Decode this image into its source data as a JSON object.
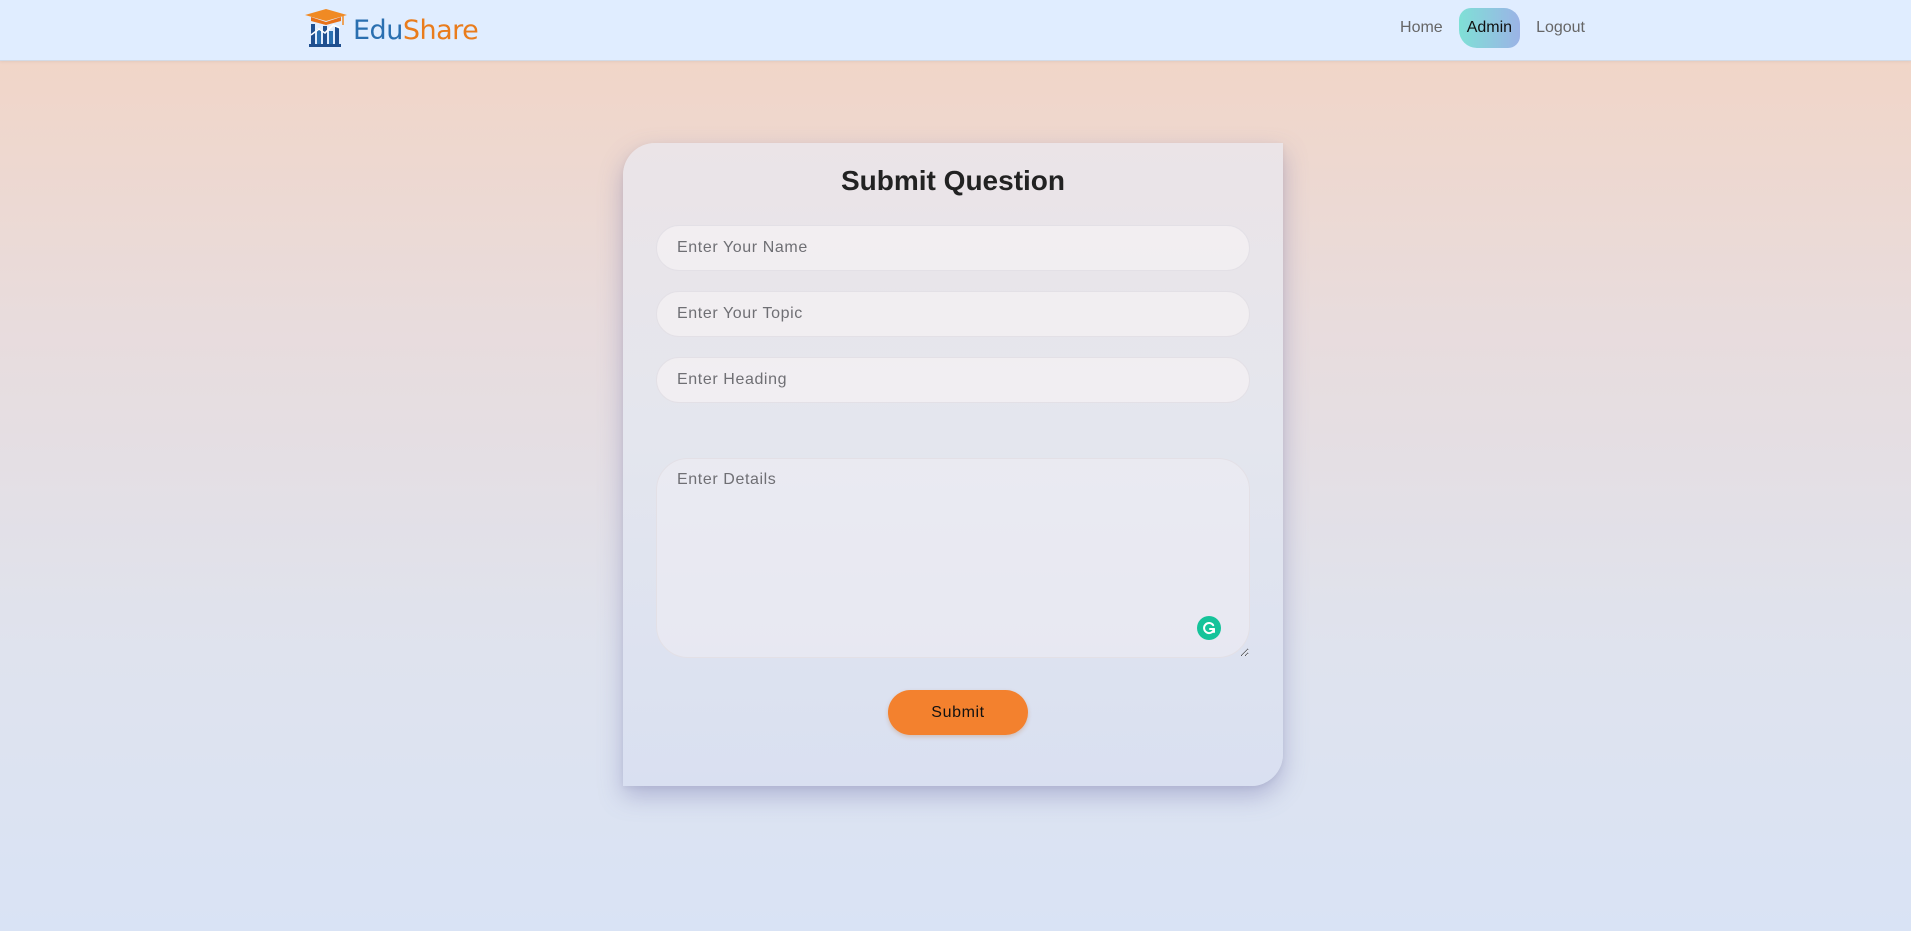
{
  "brand": {
    "name_part1": "Edu",
    "name_part2": "Share",
    "logo_icon": "graduation-cap-chart-icon"
  },
  "nav": {
    "items": [
      {
        "label": "Home",
        "active": false
      },
      {
        "label": "Admin",
        "active": true
      },
      {
        "label": "Logout",
        "active": false
      }
    ]
  },
  "form": {
    "title": "Submit Question",
    "name_placeholder": "Enter Your Name",
    "topic_placeholder": "Enter Your Topic",
    "heading_placeholder": "Enter Heading",
    "details_placeholder": "Enter Details",
    "submit_label": "Submit",
    "grammarly_icon": "grammarly-icon"
  },
  "colors": {
    "accent_orange": "#f3812e",
    "brand_blue": "#2a6fb0",
    "brand_orange": "#e97c1c",
    "grammarly_green": "#15c39a",
    "navbar_bg": "#e0edff"
  }
}
